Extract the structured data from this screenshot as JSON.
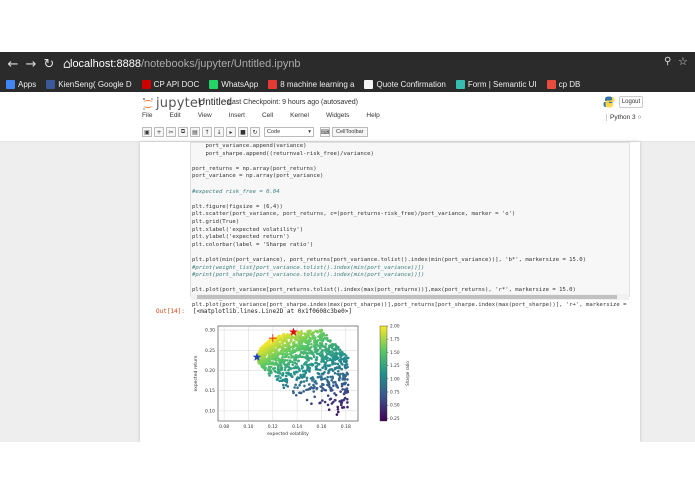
{
  "browser": {
    "url_host": "localhost:8888",
    "url_path": "/notebooks/jupyter/Untitled.ipynb",
    "bookmarks": [
      {
        "label": "Apps",
        "color": "#4285f4"
      },
      {
        "label": "KienSeng( Google D",
        "color": "#3b5998"
      },
      {
        "label": "CP API DOC",
        "color": "#cc0000"
      },
      {
        "label": "WhatsApp",
        "color": "#25d366"
      },
      {
        "label": "8 machine learning a",
        "color": "#e53935"
      },
      {
        "label": "Quote Confirmation",
        "color": "#f5f5f5"
      },
      {
        "label": "Form | Semantic UI",
        "color": "#35bdb2"
      },
      {
        "label": "cp DB",
        "color": "#e74c3c"
      }
    ]
  },
  "jupyter": {
    "logo_text": "jupyter",
    "notebook_name": "Untitled",
    "checkpoint": "Last Checkpoint: 9 hours ago (autosaved)",
    "logout_label": "Logout",
    "kernel": "Python 3",
    "menu": [
      "File",
      "Edit",
      "View",
      "Insert",
      "Cell",
      "Kernel",
      "Widgets",
      "Help"
    ],
    "cell_type": "Code",
    "cell_toolbar_label": "CellToolbar"
  },
  "code_lines": [
    {
      "t": "    port_variance.append(variance)",
      "c": ""
    },
    {
      "t": "    port_sharpe.append((returnval-risk_free)/variance)",
      "c": ""
    },
    {
      "t": "",
      "c": ""
    },
    {
      "t": "port_returns = np.array(port_returns)",
      "c": ""
    },
    {
      "t": "port_variance = np.array(port_variance)",
      "c": ""
    },
    {
      "t": "",
      "c": ""
    },
    {
      "t": "#expected risk_free = 0.04",
      "c": "com"
    },
    {
      "t": "",
      "c": ""
    },
    {
      "t": "plt.figure(figsize = (6,4))",
      "c": ""
    },
    {
      "t": "plt.scatter(port_variance, port_returns, c=(port_returns-risk_free)/port_variance, marker = 'o')",
      "c": ""
    },
    {
      "t": "plt.grid(True)",
      "c": ""
    },
    {
      "t": "plt.xlabel('expected volatility')",
      "c": ""
    },
    {
      "t": "plt.ylabel('expected return')",
      "c": ""
    },
    {
      "t": "plt.colorbar(label = 'Sharpe ratio')",
      "c": ""
    },
    {
      "t": "",
      "c": ""
    },
    {
      "t": "plt.plot(min(port_variance), port_returns[port_variance.tolist().index(min(port_variance))], 'b*', markersize = 15.0)",
      "c": ""
    },
    {
      "t": "#print(weight_list[port_variance.tolist().index(min(port_variance))])",
      "c": "com"
    },
    {
      "t": "#print(port_sharpe[port_variance.tolist().index(min(port_variance))])",
      "c": "com"
    },
    {
      "t": "",
      "c": ""
    },
    {
      "t": "plt.plot(port_variance[port_returns.tolist().index(max(port_returns))],max(port_returns), 'r*', markersize = 15.0)",
      "c": ""
    },
    {
      "t": "max(port_sharpe)",
      "c": ""
    },
    {
      "t": "plt.plot(port_variance[port_sharpe.index(max(port_sharpe))],port_returns[port_sharpe.index(max(port_sharpe))], 'r+', markersize =",
      "c": ""
    }
  ],
  "output": {
    "prompt": "Out[14]:",
    "text": "[<matplotlib.lines.Line2D at 0x1f0608c3be0>]"
  },
  "chart_data": {
    "type": "scatter",
    "xlabel": "expected volatility",
    "ylabel": "expected return",
    "colorbar_label": "Sharpe ratio",
    "xlim": [
      0.075,
      0.19
    ],
    "ylim": [
      0.075,
      0.31
    ],
    "xticks": [
      "0.08",
      "0.10",
      "0.12",
      "0.14",
      "0.16",
      "0.18"
    ],
    "yticks": [
      "0.10",
      "0.15",
      "0.20",
      "0.25",
      "0.30"
    ],
    "colorbar_ticks": [
      "0.25",
      "0.50",
      "0.75",
      "1.00",
      "1.25",
      "1.50",
      "1.75",
      "2.00"
    ],
    "colorbar_range": [
      0.2,
      2.0
    ],
    "grid": true,
    "markers": [
      {
        "label": "min volatility",
        "x": 0.107,
        "y": 0.233,
        "color": "#1f3fbf",
        "symbol": "star"
      },
      {
        "label": "max return",
        "x": 0.137,
        "y": 0.295,
        "color": "#e01010",
        "symbol": "star"
      },
      {
        "label": "max sharpe",
        "x": 0.12,
        "y": 0.28,
        "color": "#e01010",
        "symbol": "plus"
      }
    ],
    "frontier_upper": [
      [
        0.107,
        0.233
      ],
      [
        0.11,
        0.255
      ],
      [
        0.115,
        0.27
      ],
      [
        0.12,
        0.281
      ],
      [
        0.13,
        0.291
      ],
      [
        0.14,
        0.297
      ],
      [
        0.15,
        0.3
      ],
      [
        0.16,
        0.302
      ]
    ],
    "frontier_lower": [
      [
        0.107,
        0.233
      ],
      [
        0.11,
        0.205
      ],
      [
        0.12,
        0.175
      ],
      [
        0.13,
        0.152
      ],
      [
        0.14,
        0.132
      ],
      [
        0.15,
        0.115
      ],
      [
        0.16,
        0.102
      ],
      [
        0.17,
        0.092
      ],
      [
        0.18,
        0.085
      ]
    ]
  }
}
